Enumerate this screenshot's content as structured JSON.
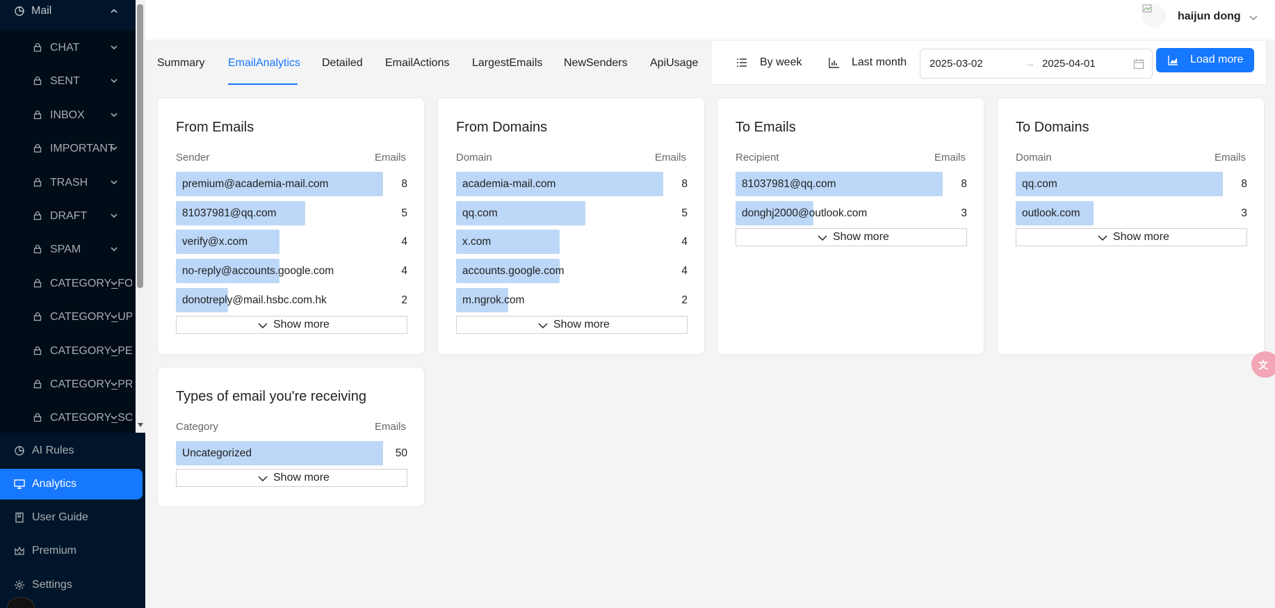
{
  "sidebar": {
    "mail_label": "Mail",
    "mail_items": [
      {
        "label": "CHAT"
      },
      {
        "label": "SENT"
      },
      {
        "label": "INBOX"
      },
      {
        "label": "IMPORTANT"
      },
      {
        "label": "TRASH"
      },
      {
        "label": "DRAFT"
      },
      {
        "label": "SPAM"
      },
      {
        "label": "CATEGORY_FORUMS"
      },
      {
        "label": "CATEGORY_UPDATES"
      },
      {
        "label": "CATEGORY_PERSONAL"
      },
      {
        "label": "CATEGORY_PROMOTIONS"
      },
      {
        "label": "CATEGORY_SOCIAL"
      }
    ],
    "nav_items": [
      {
        "label": "AI Rules",
        "icon": "pie-icon"
      },
      {
        "label": "Analytics",
        "icon": "monitor-icon",
        "active": true
      },
      {
        "label": "User Guide",
        "icon": "book-icon"
      },
      {
        "label": "Premium",
        "icon": "crown-icon"
      },
      {
        "label": "Settings",
        "icon": "gear-icon"
      }
    ]
  },
  "header": {
    "user_name": "haijun dong"
  },
  "tabs": [
    {
      "label": "Summary"
    },
    {
      "label": "EmailAnalytics",
      "active": true
    },
    {
      "label": "Detailed"
    },
    {
      "label": "EmailActions"
    },
    {
      "label": "LargestEmails"
    },
    {
      "label": "NewSenders"
    },
    {
      "label": "ApiUsage"
    }
  ],
  "controls": {
    "group_by": "By week",
    "period": "Last month",
    "date_start": "2025-03-02",
    "date_end": "2025-04-01",
    "separator": "→",
    "load_more": "Load more"
  },
  "cards": [
    {
      "title": "From Emails",
      "col_left": "Sender",
      "col_right": "Emails",
      "max": 8,
      "rows": [
        {
          "label": "premium@academia-mail.com",
          "value": 8
        },
        {
          "label": "81037981@qq.com",
          "value": 5
        },
        {
          "label": "verify@x.com",
          "value": 4
        },
        {
          "label": "no-reply@accounts.google.com",
          "value": 4
        },
        {
          "label": "donotreply@mail.hsbc.com.hk",
          "value": 2
        }
      ],
      "show_more": "Show more"
    },
    {
      "title": "From Domains",
      "col_left": "Domain",
      "col_right": "Emails",
      "max": 8,
      "rows": [
        {
          "label": "academia-mail.com",
          "value": 8
        },
        {
          "label": "qq.com",
          "value": 5
        },
        {
          "label": "x.com",
          "value": 4
        },
        {
          "label": "accounts.google.com",
          "value": 4
        },
        {
          "label": "m.ngrok.com",
          "value": 2
        }
      ],
      "show_more": "Show more"
    },
    {
      "title": "To Emails",
      "col_left": "Recipient",
      "col_right": "Emails",
      "max": 8,
      "rows": [
        {
          "label": "81037981@qq.com",
          "value": 8
        },
        {
          "label": "donghj2000@outlook.com",
          "value": 3
        }
      ],
      "show_more": "Show more"
    },
    {
      "title": "To Domains",
      "col_left": "Domain",
      "col_right": "Emails",
      "max": 8,
      "rows": [
        {
          "label": "qq.com",
          "value": 8
        },
        {
          "label": "outlook.com",
          "value": 3
        }
      ],
      "show_more": "Show more"
    },
    {
      "title": "Types of email you're receiving",
      "col_left": "Category",
      "col_right": "Emails",
      "max": 50,
      "rows": [
        {
          "label": "Uncategorized",
          "value": 50
        }
      ],
      "show_more": "Show more"
    }
  ],
  "colors": {
    "accent": "#1677ff",
    "sidebar_bg": "#001529",
    "bar_fill": "#bcd7f7"
  }
}
